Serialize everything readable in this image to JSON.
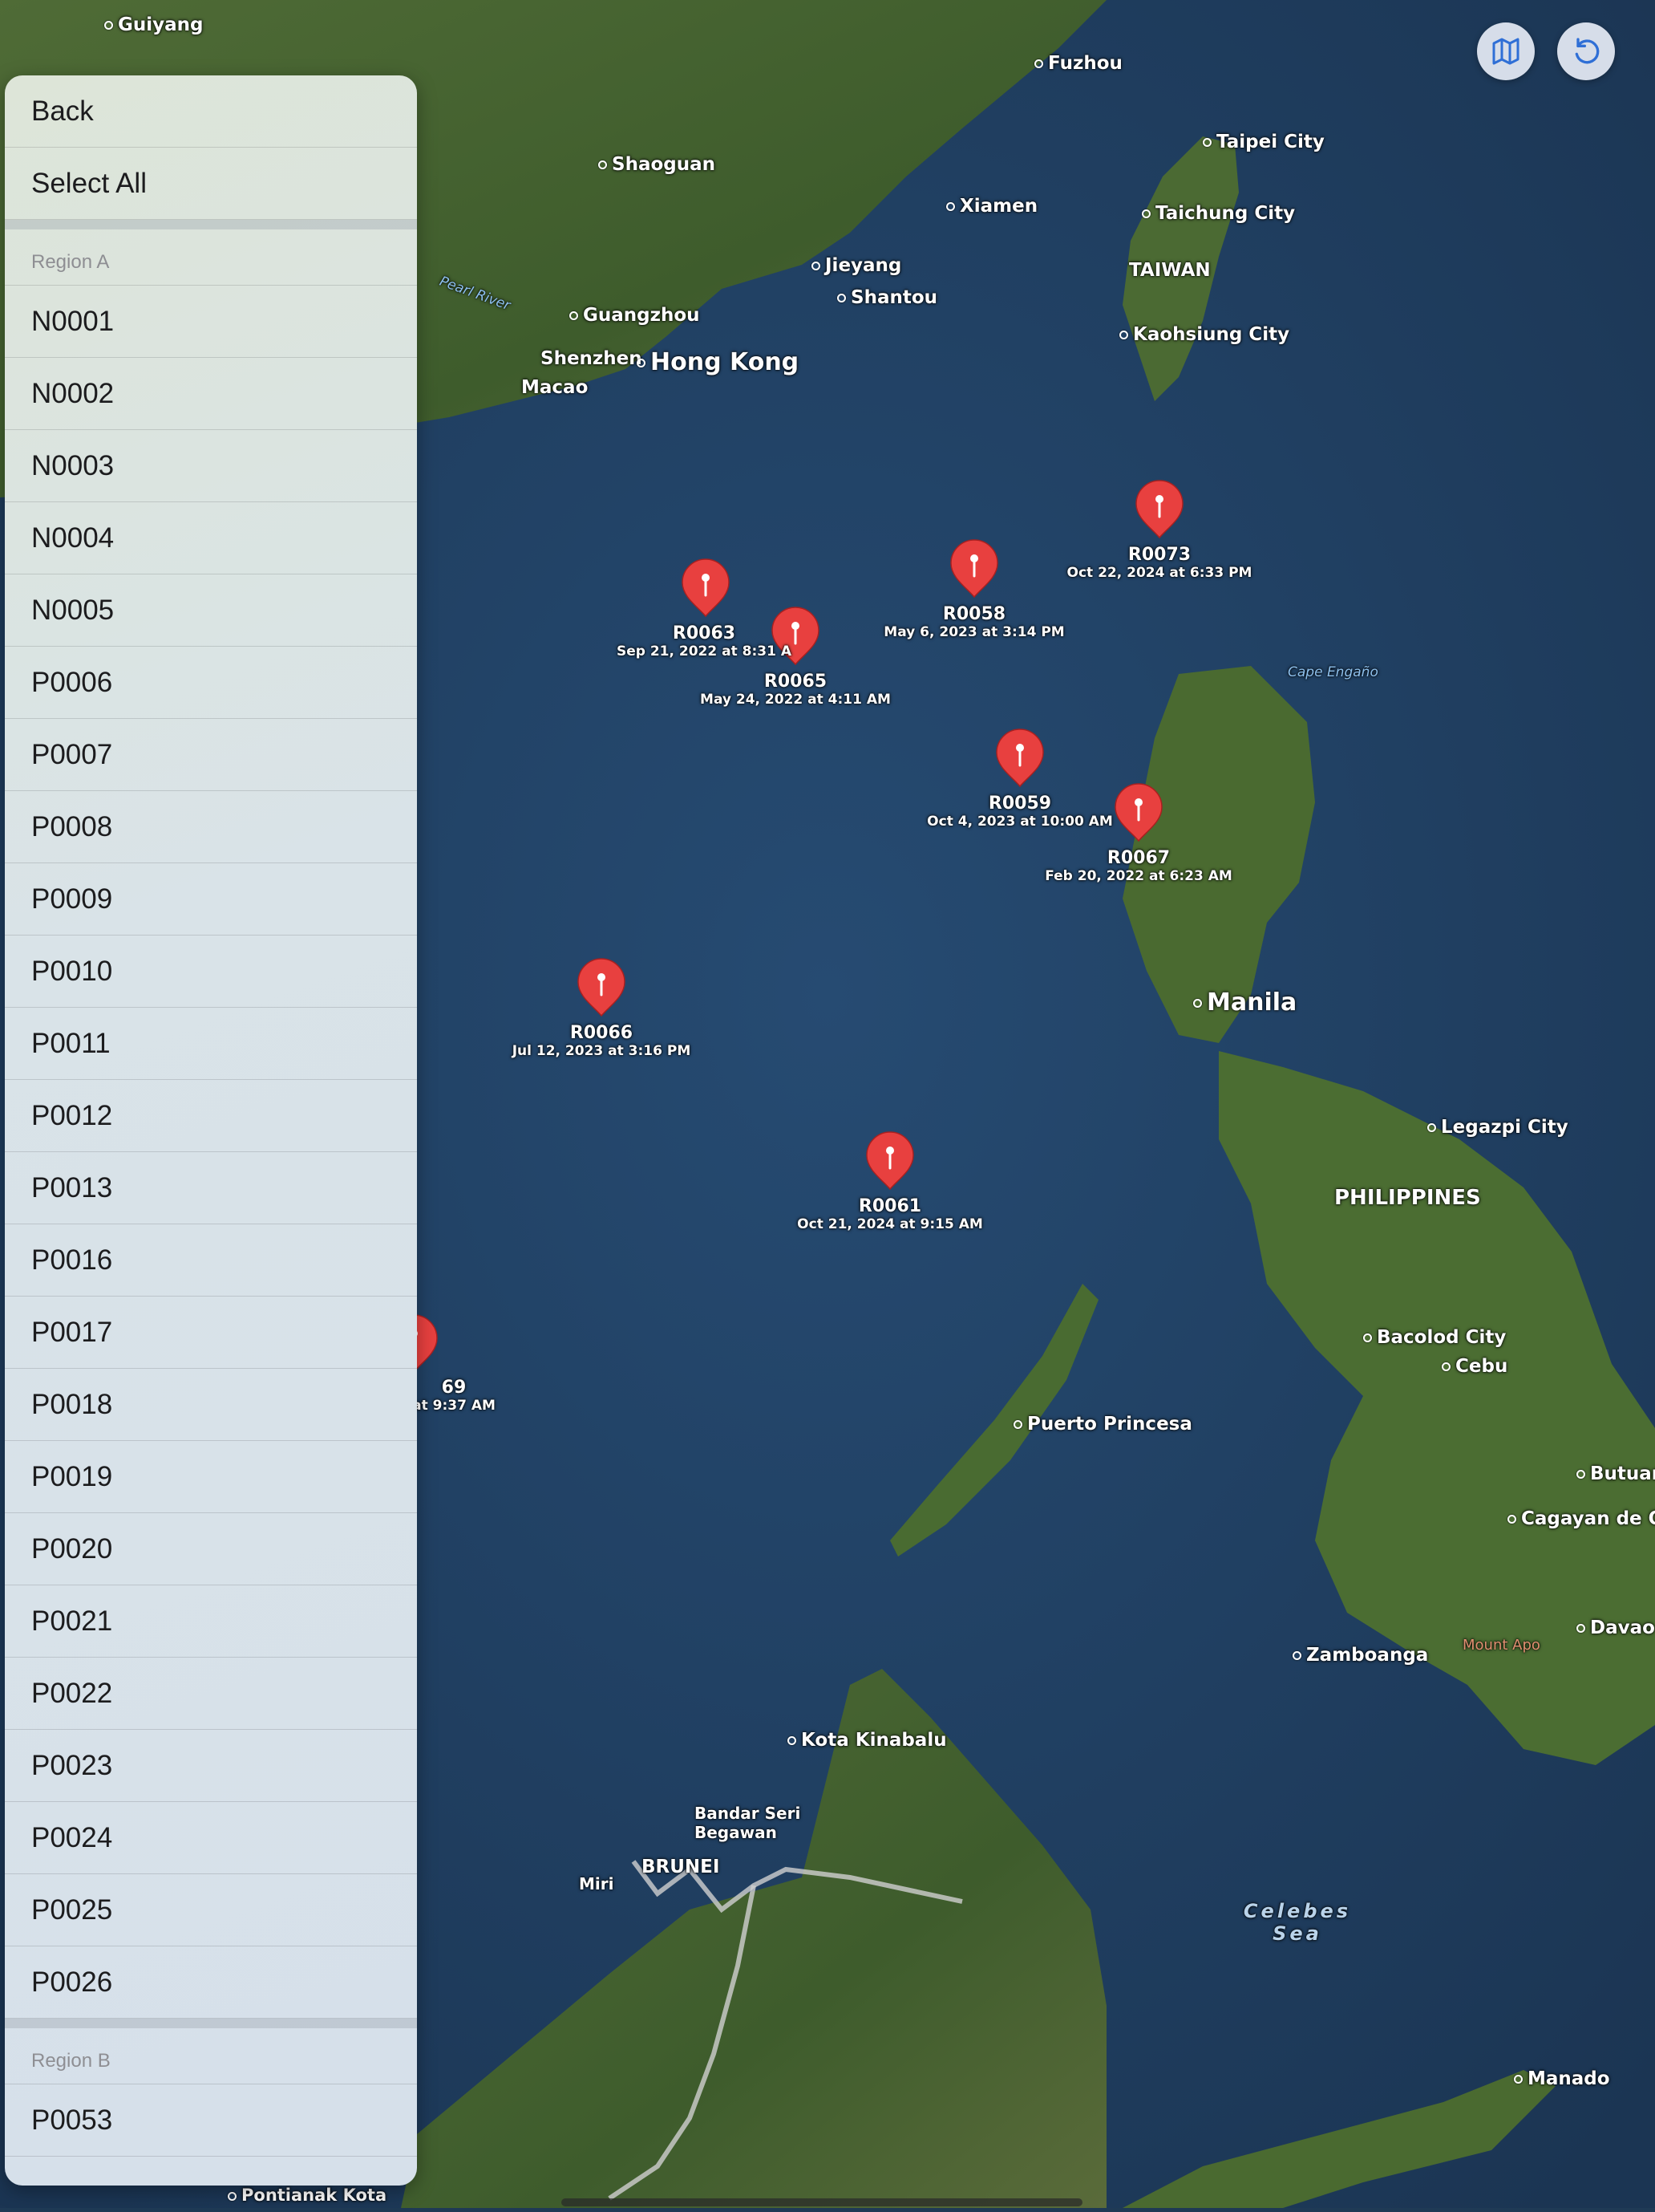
{
  "map": {
    "places": [
      {
        "name": "Guiyang",
        "size": "med"
      },
      {
        "name": "Fuzhou",
        "size": "med"
      },
      {
        "name": "Taipei City",
        "size": "med"
      },
      {
        "name": "Taichung City",
        "size": "med"
      },
      {
        "name": "TAIWAN",
        "size": "med"
      },
      {
        "name": "Kaohsiung City",
        "size": "med"
      },
      {
        "name": "Shaoguan",
        "size": "med"
      },
      {
        "name": "Xiamen",
        "size": "med"
      },
      {
        "name": "Jieyang",
        "size": "med"
      },
      {
        "name": "Shantou",
        "size": "med"
      },
      {
        "name": "Guangzhou",
        "size": "med"
      },
      {
        "name": "Shenzhen",
        "size": "med"
      },
      {
        "name": "Hong Kong",
        "size": "big"
      },
      {
        "name": "Macao",
        "size": "med"
      },
      {
        "name": "Pearl River",
        "size": "small-blue"
      },
      {
        "name": "Cape Engaño",
        "size": "small-blue"
      },
      {
        "name": "Manila",
        "size": "big"
      },
      {
        "name": "Legazpi City",
        "size": "med"
      },
      {
        "name": "PHILIPPINES",
        "size": "med"
      },
      {
        "name": "Bacolod City",
        "size": "med"
      },
      {
        "name": "Cebu",
        "size": "med"
      },
      {
        "name": "Puerto Princesa",
        "size": "med"
      },
      {
        "name": "Butuan",
        "size": "med"
      },
      {
        "name": "Cagayan de Oro",
        "size": "med"
      },
      {
        "name": "Davao",
        "size": "med"
      },
      {
        "name": "Mount Apo",
        "size": "mount"
      },
      {
        "name": "Zamboanga",
        "size": "med"
      },
      {
        "name": "Kota Kinabalu",
        "size": "med"
      },
      {
        "name": "Bandar Seri Begawan",
        "size": "med"
      },
      {
        "name": "BRUNEI",
        "size": "med"
      },
      {
        "name": "Miri",
        "size": "med"
      },
      {
        "name": "Celebes Sea",
        "size": "sea"
      },
      {
        "name": "Manado",
        "size": "med"
      },
      {
        "name": "Pontianak Kota",
        "size": "med"
      }
    ],
    "pins": [
      {
        "id": "R0073",
        "date": "Oct 22, 2024 at 6:33 PM"
      },
      {
        "id": "R0058",
        "date": "May 6, 2023 at 3:14 PM"
      },
      {
        "id": "R0063",
        "date": "Sep 21, 2022 at 8:31 A"
      },
      {
        "id": "R0065",
        "date": "May 24, 2022 at 4:11 AM"
      },
      {
        "id": "R0059",
        "date": "Oct 4, 2023 at 10:00 AM"
      },
      {
        "id": "R0067",
        "date": "Feb 20, 2022 at 6:23 AM"
      },
      {
        "id": "R0066",
        "date": "Jul 12, 2023 at 3:16 PM"
      },
      {
        "id": "R0061",
        "date": "Oct 21, 2024 at 9:15 AM"
      },
      {
        "id": "69",
        "date": "at 9:37 AM"
      }
    ],
    "pin_color": "#e8403f"
  },
  "sidebar": {
    "back_label": "Back",
    "select_all_label": "Select All",
    "sections": [
      {
        "header": "Region A",
        "items": [
          "N0001",
          "N0002",
          "N0003",
          "N0004",
          "N0005",
          "P0006",
          "P0007",
          "P0008",
          "P0009",
          "P0010",
          "P0011",
          "P0012",
          "P0013",
          "P0016",
          "P0017",
          "P0018",
          "P0019",
          "P0020",
          "P0021",
          "P0022",
          "P0023",
          "P0024",
          "P0025",
          "P0026"
        ]
      },
      {
        "header": "Region B",
        "items": [
          "P0053"
        ]
      }
    ]
  },
  "toolbar": {
    "map_type_icon": "map-icon",
    "reset_icon": "rotate-icon",
    "accent": "#2f6fd6"
  }
}
